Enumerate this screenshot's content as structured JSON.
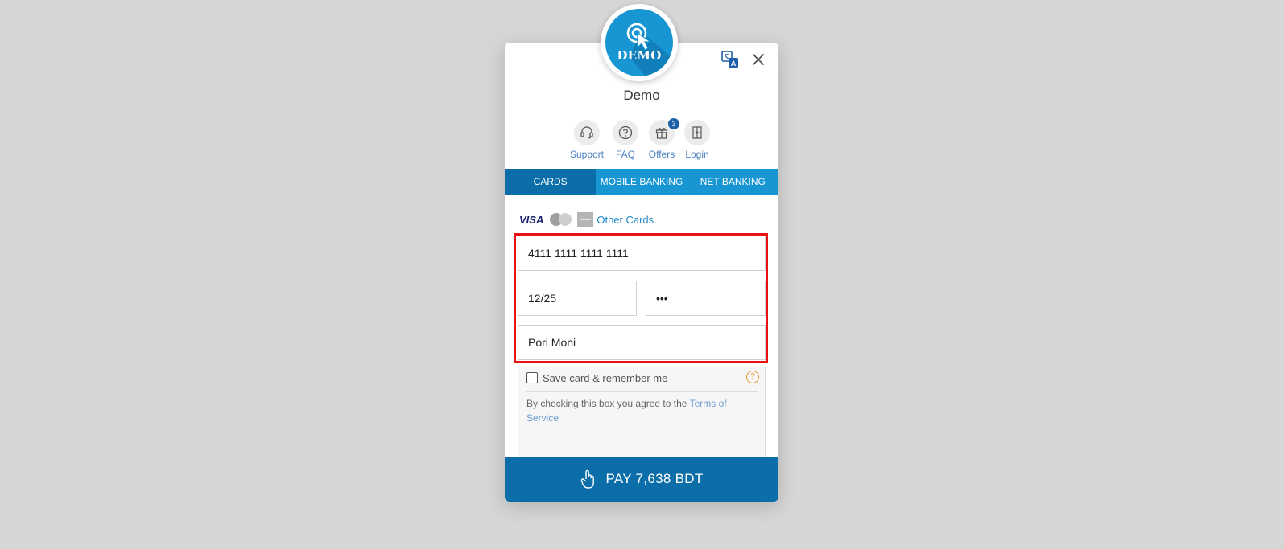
{
  "merchant": {
    "logo_text": "DEMO",
    "name": "Demo"
  },
  "header_icons": {
    "language": "translate-icon",
    "close": "close-icon"
  },
  "quick_links": [
    {
      "label": "Support",
      "icon": "headset-icon"
    },
    {
      "label": "FAQ",
      "icon": "question-icon"
    },
    {
      "label": "Offers",
      "icon": "gift-icon",
      "badge": "3"
    },
    {
      "label": "Login",
      "icon": "login-icon"
    }
  ],
  "tabs": [
    {
      "label": "CARDS",
      "active": true
    },
    {
      "label": "MOBILE BANKING",
      "active": false
    },
    {
      "label": "NET BANKING",
      "active": false
    }
  ],
  "card_brands": {
    "visa": "VISA",
    "other_cards": "Other Cards"
  },
  "form": {
    "card_number": "4111 1111 1111 1111",
    "expiry": "12/25",
    "cvv": "•••",
    "cardholder": "Pori Moni"
  },
  "save_card": {
    "label": "Save card & remember me",
    "checked": false,
    "help": "?",
    "terms_prefix": "By checking this box you agree to the ",
    "terms_link": "Terms of Service"
  },
  "pay_button": {
    "label": "PAY 7,638 BDT"
  },
  "colors": {
    "primary": "#1896d3",
    "primary_dark": "#0b6ea8",
    "highlight": "#e81010",
    "background": "#d6d6d6"
  }
}
